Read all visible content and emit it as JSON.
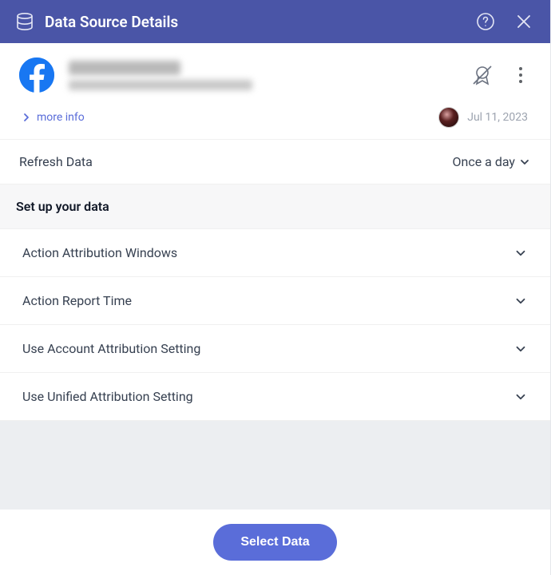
{
  "header": {
    "title": "Data Source Details"
  },
  "more_info": {
    "label": "more info",
    "date": "Jul 11, 2023"
  },
  "refresh": {
    "label": "Refresh Data",
    "value": "Once a day"
  },
  "setup_section": {
    "title": "Set up your data",
    "items": [
      {
        "label": "Action Attribution Windows"
      },
      {
        "label": "Action Report Time"
      },
      {
        "label": "Use Account Attribution Setting"
      },
      {
        "label": "Use Unified Attribution Setting"
      }
    ]
  },
  "footer": {
    "select_label": "Select Data"
  }
}
